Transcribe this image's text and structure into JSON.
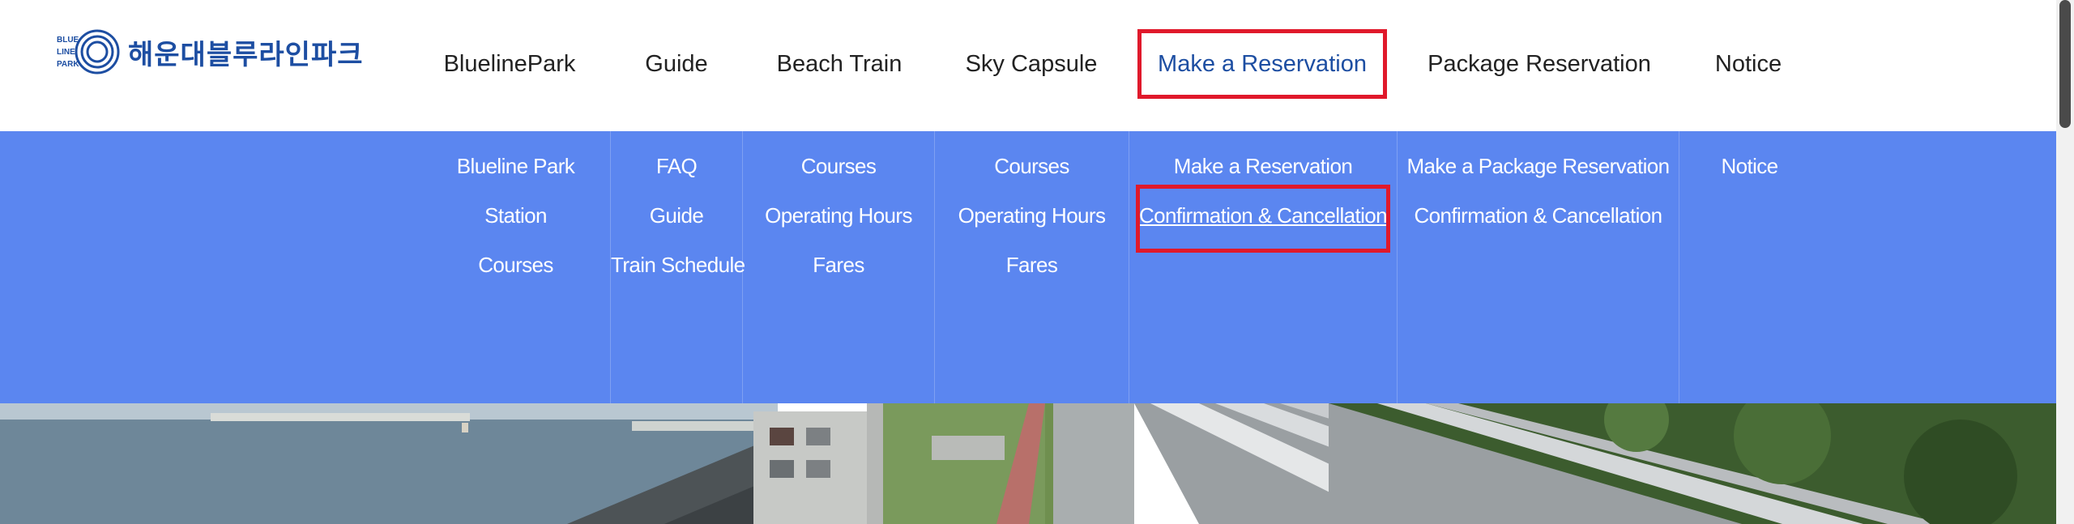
{
  "logo": {
    "mark_lines": [
      "BLUE",
      "LINE",
      "PARK"
    ],
    "text": "해운대블루라인파크",
    "brand_color": "#1d4ea2"
  },
  "gnb": [
    {
      "label": "BluelinePark"
    },
    {
      "label": "Guide"
    },
    {
      "label": "Beach Train"
    },
    {
      "label": "Sky Capsule"
    },
    {
      "label": "Make a Reservation"
    },
    {
      "label": "Package Reservation"
    },
    {
      "label": "Notice"
    }
  ],
  "dropdown": {
    "background": "#5b86f0",
    "columns": [
      {
        "items": [
          "Blueline Park",
          "Station",
          "Courses"
        ]
      },
      {
        "items": [
          "FAQ",
          "Guide",
          "Train Schedule"
        ]
      },
      {
        "items": [
          "Courses",
          "Operating Hours",
          "Fares"
        ]
      },
      {
        "items": [
          "Courses",
          "Operating Hours",
          "Fares"
        ]
      },
      {
        "items": [
          "Make a Reservation",
          "Confirmation & Cancellation"
        ]
      },
      {
        "items": [
          "Make a Package Reservation",
          "Confirmation & Cancellation"
        ]
      },
      {
        "items": [
          "Notice"
        ]
      }
    ]
  },
  "highlight_color": "#e0192b",
  "active_menu": "Make a Reservation",
  "hovered_submenu": "Confirmation & Cancellation"
}
